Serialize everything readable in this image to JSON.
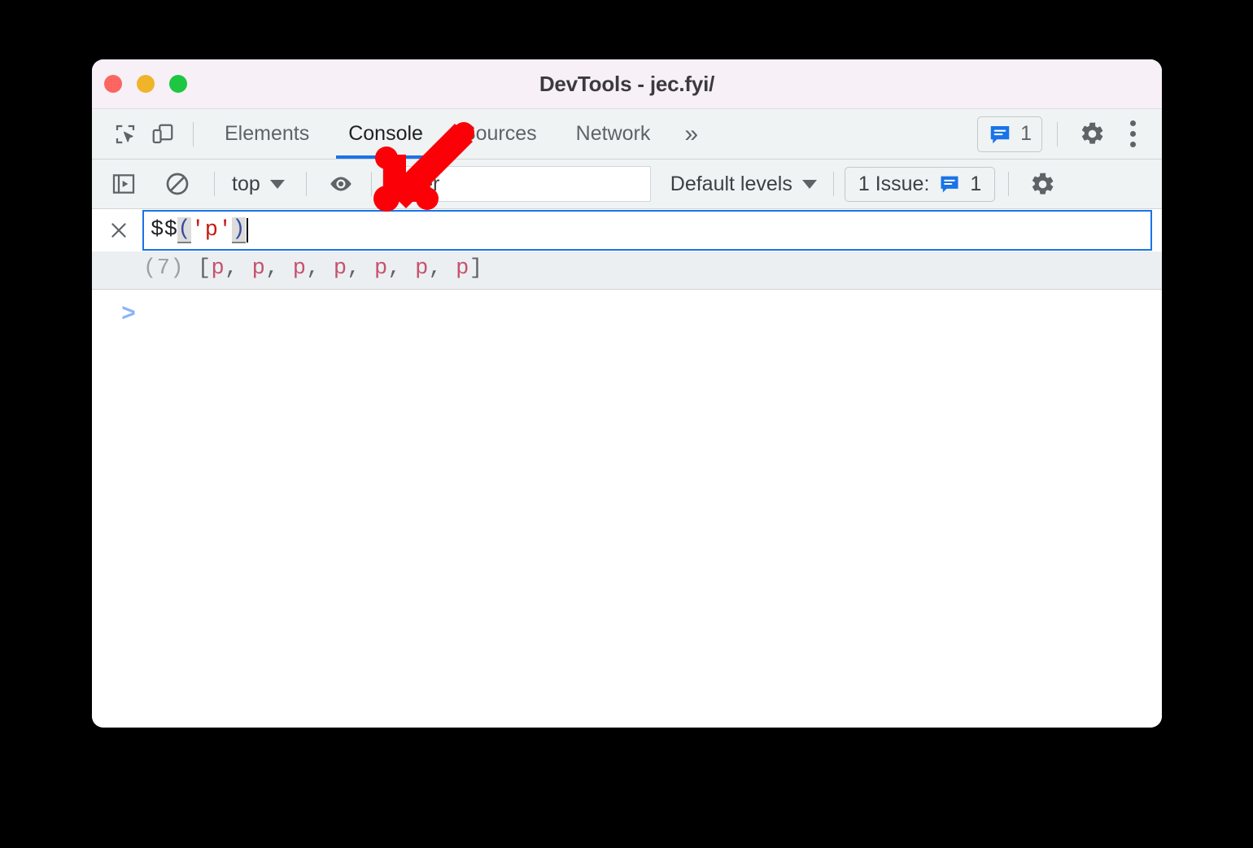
{
  "window": {
    "title": "DevTools - jec.fyi/",
    "traffic_lights": [
      "close-red",
      "minimize-yellow",
      "maximize-green"
    ]
  },
  "tabbar": {
    "inspect_icon": "inspect-element-icon",
    "device_icon": "device-toolbar-icon",
    "tabs": [
      {
        "label": "Elements",
        "active": false
      },
      {
        "label": "Console",
        "active": true
      },
      {
        "label": "Sources",
        "active": false
      },
      {
        "label": "Network",
        "active": false
      }
    ],
    "overflow_label": "»",
    "issues_chip": {
      "icon": "issues-speech-bubble-icon",
      "count": "1"
    },
    "settings_icon": "gear-icon",
    "more_icon": "more-vertical-icon"
  },
  "console_toolbar": {
    "sidebar_icon": "console-sidebar-icon",
    "clear_icon": "clear-console-icon",
    "context": {
      "label": "top",
      "caret": "chevron-down-icon"
    },
    "eye_icon": "live-expression-eye-icon",
    "filter": {
      "value": "",
      "placeholder": "Filter"
    },
    "levels": {
      "label": "Default levels",
      "caret": "chevron-down-icon"
    },
    "issues": {
      "label": "1 Issue:",
      "icon": "issues-speech-bubble-icon",
      "count": "1"
    },
    "settings_icon": "gear-icon"
  },
  "console": {
    "close_icon": "close-icon",
    "command": {
      "fn": "$$",
      "open_paren": "(",
      "string": "'p'",
      "close_paren": ")"
    },
    "result": {
      "count": "(7)",
      "open": "[",
      "items": [
        "p",
        "p",
        "p",
        "p",
        "p",
        "p",
        "p"
      ],
      "sep": ", ",
      "close": "]"
    },
    "prompt": ">"
  },
  "annotation": {
    "arrow": "red-arrow-pointing-down-left",
    "color": "#fb0007"
  },
  "colors": {
    "accent_blue": "#1a73e8",
    "titlebar": "#f7f0f7",
    "toolbar": "#eff3f3",
    "result_bg": "#eceff1",
    "string_red": "#c41a16",
    "tag_pink": "#c5526e"
  }
}
